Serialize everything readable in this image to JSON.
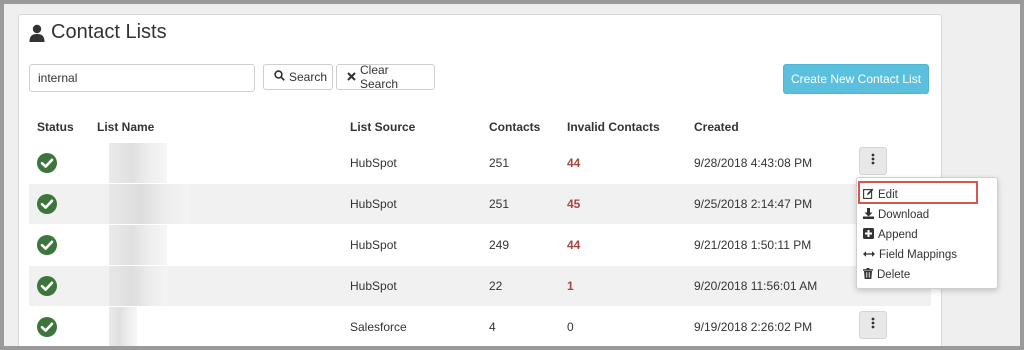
{
  "page": {
    "title": "Contact Lists",
    "title_icon": "user-icon"
  },
  "toolbar": {
    "search_value": "internal",
    "search_label": "Search",
    "clear_label": "Clear Search",
    "create_label": "Create New Contact List"
  },
  "table": {
    "headers": {
      "status": "Status",
      "name": "List Name",
      "source": "List Source",
      "contacts": "Contacts",
      "invalid": "Invalid Contacts",
      "created": "Created"
    },
    "rows": [
      {
        "source": "HubSpot",
        "contacts": "251",
        "invalid": "44",
        "created": "9/28/2018 4:43:08 PM",
        "status": "check-circle-icon"
      },
      {
        "source": "HubSpot",
        "contacts": "251",
        "invalid": "45",
        "created": "9/25/2018 2:14:47 PM",
        "status": "check-circle-icon"
      },
      {
        "source": "HubSpot",
        "contacts": "249",
        "invalid": "44",
        "created": "9/21/2018 1:50:11 PM",
        "status": "check-circle-icon"
      },
      {
        "source": "HubSpot",
        "contacts": "22",
        "invalid": "1",
        "created": "9/20/2018 11:56:01 AM",
        "status": "check-circle-icon"
      },
      {
        "source": "Salesforce",
        "contacts": "4",
        "invalid": "0",
        "created": "9/19/2018 2:26:02 PM",
        "status": "check-circle-icon"
      }
    ]
  },
  "dropdown_menu": {
    "items": [
      {
        "label": "Edit",
        "icon": "edit-icon"
      },
      {
        "label": "Download",
        "icon": "download-icon"
      },
      {
        "label": "Append",
        "icon": "plus-square-icon"
      },
      {
        "label": "Field Mappings",
        "icon": "arrows-h-icon"
      },
      {
        "label": "Delete",
        "icon": "trash-icon"
      }
    ]
  },
  "colors": {
    "accent": "#5bc0de",
    "status_ok": "#3c763d",
    "invalid_count": "#a94442",
    "highlight": "#d9534f"
  }
}
